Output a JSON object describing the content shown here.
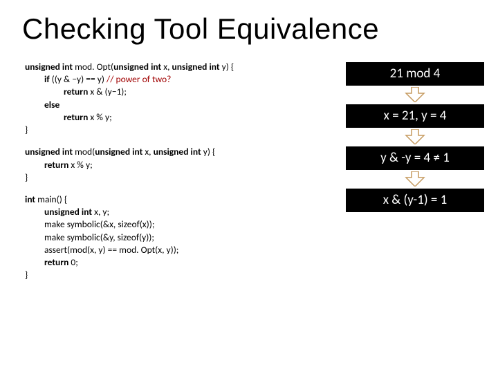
{
  "title": "Checking Tool Equivalence",
  "code": {
    "modOpt": {
      "sig_a": "unsigned int ",
      "sig_b": "mod. Opt(",
      "sig_c": "unsigned int ",
      "sig_d": "x, ",
      "sig_e": "unsigned int ",
      "sig_f": "y) {",
      "l1a": "if ",
      "l1b": "((y & −y) == y) ",
      "l1c": "// power of two?",
      "l2a": "return ",
      "l2b": "x & (y−1);",
      "l3": "else",
      "l4a": "return ",
      "l4b": "x % y;",
      "l5": "}"
    },
    "mod": {
      "sig_a": "unsigned int ",
      "sig_b": "mod(",
      "sig_c": "unsigned int ",
      "sig_d": "x, ",
      "sig_e": "unsigned int ",
      "sig_f": "y) {",
      "l1a": "return ",
      "l1b": "x % y;",
      "l2": "}"
    },
    "main": {
      "sig_a": "int ",
      "sig_b": "main() {",
      "l1a": "unsigned int ",
      "l1b": "x, y;",
      "l2": "make symbolic(&x, sizeof(x));",
      "l3": "make symbolic(&y, sizeof(y));",
      "l4": "assert(mod(x, y) == mod. Opt(x, y));",
      "l5a": "return ",
      "l5b": "0;",
      "l6": "}"
    }
  },
  "boxes": {
    "b1": "21 mod 4",
    "b2": "x = 21, y = 4",
    "b3": "y & -y = 4 ≠ 1",
    "b4": "x & (y-1) = 1"
  },
  "colors": {
    "box_bg": "#000000",
    "box_fg": "#ffffff",
    "comment": "#a00000"
  }
}
